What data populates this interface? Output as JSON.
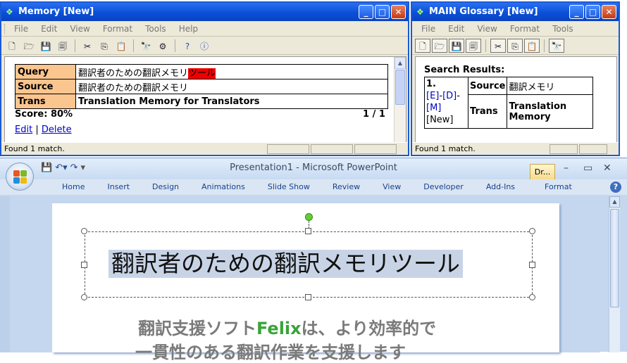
{
  "memory": {
    "title": "Memory [New]",
    "menu": [
      "File",
      "Edit",
      "View",
      "Format",
      "Tools",
      "Help"
    ],
    "rows": [
      {
        "label": "Query",
        "text": "翻訳者のための翻訳メモリ",
        "highlight": "ツール"
      },
      {
        "label": "Source",
        "text": "翻訳者のための翻訳メモリ"
      },
      {
        "label": "Trans",
        "text": "Translation Memory for Translators"
      }
    ],
    "score": "Score: 80%",
    "count": "1 / 1",
    "edit": "Edit",
    "sep": "|",
    "delete": "Delete",
    "status": "Found 1 match."
  },
  "glossary": {
    "title": "MAIN Glossary [New]",
    "menu": [
      "File",
      "Edit",
      "View",
      "Format",
      "Tools"
    ],
    "heading": "Search Results:",
    "num": "1.",
    "link_e": "[E]",
    "dash1": "-",
    "link_d": "[D]",
    "dash2": "-",
    "link_m": "[M]",
    "new": "[New]",
    "source_label": "Source",
    "source_value": "翻訳メモリ",
    "trans_label": "Trans",
    "trans_value": "Translation Memory",
    "status": "Found 1 match."
  },
  "ppt": {
    "title": "Presentation1 - Microsoft PowerPoint",
    "doc_tab": "Dr...",
    "tabs": [
      "Home",
      "Insert",
      "Design",
      "Animations",
      "Slide Show",
      "Review",
      "View",
      "Developer",
      "Add-Ins",
      "Format"
    ],
    "slide_title": "翻訳者のための翻訳メモリツール",
    "sub_a": "翻訳支援ソフト",
    "sub_green": "Felix",
    "sub_b": "は、より効率的で",
    "sub_line2": "一貫性のある翻訳作業を支援します"
  }
}
